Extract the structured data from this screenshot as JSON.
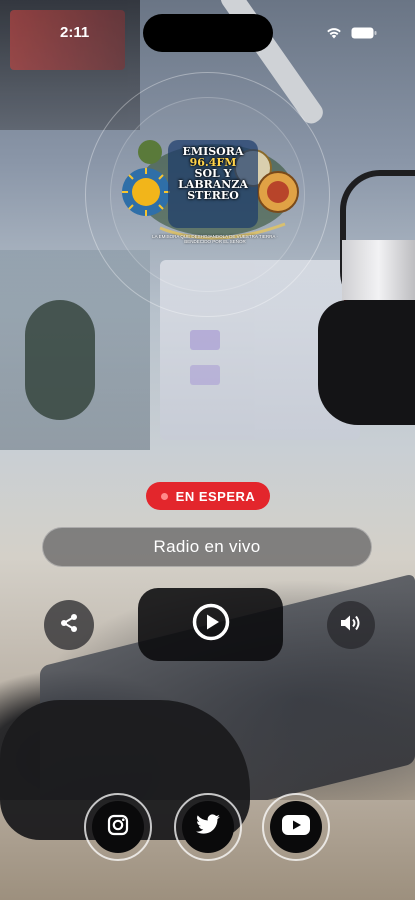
{
  "status_bar": {
    "time": "2:11"
  },
  "logo": {
    "lines": [
      "EMISORA",
      "96.4FM",
      "SOL Y",
      "LABRANZA",
      "STEREO"
    ],
    "tagline": "LA EMISORA QUE DESHOJANDOLA DE VUESTRA TIERRA · BENDECIDO POR EL SEÑOR"
  },
  "player": {
    "status_label": "EN ESPERA",
    "station_title": "Radio en vivo"
  },
  "colors": {
    "live_red": "#e3262c",
    "button_dark": "#0a0a0c"
  },
  "icons": {
    "share": "share-icon",
    "play": "play-circle-icon",
    "volume": "volume-icon",
    "instagram": "instagram-icon",
    "twitter": "twitter-icon",
    "youtube": "youtube-icon"
  }
}
